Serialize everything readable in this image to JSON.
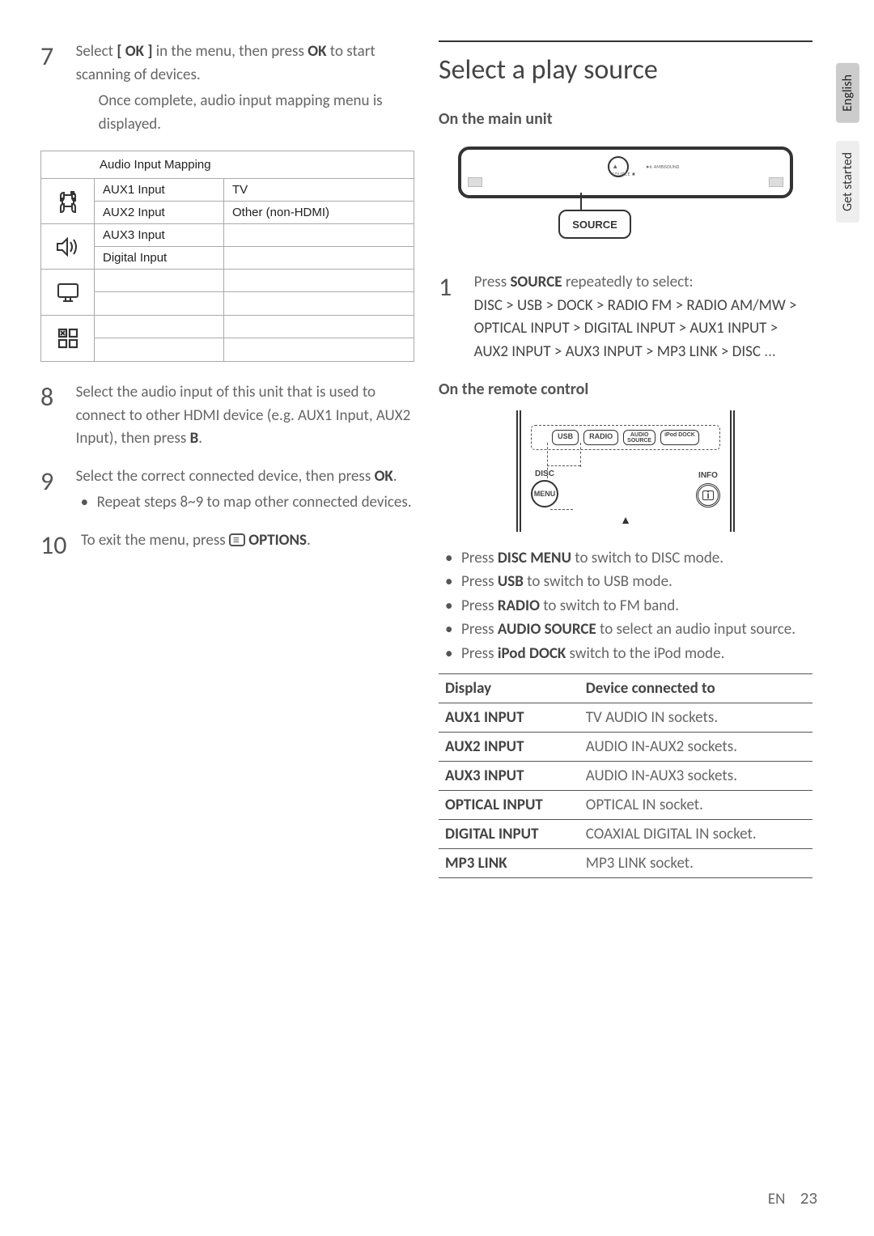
{
  "left": {
    "step7": {
      "num": "7",
      "text_a": "Select ",
      "btn1": "[ OK ]",
      "text_b": " in the menu, then press ",
      "btn2": "OK",
      "text_c": " to start scanning of devices.",
      "cont": "Once complete, audio input mapping menu is displayed."
    },
    "aim": {
      "title": "Audio Input Mapping",
      "rows": [
        {
          "l": "AUX1 Input",
          "r": "TV"
        },
        {
          "l": "AUX2 Input",
          "r": "Other (non-HDMI)"
        },
        {
          "l": "AUX3 Input",
          "r": ""
        },
        {
          "l": "Digital Input",
          "r": ""
        }
      ]
    },
    "step8": {
      "num": "8",
      "text": "Select the audio input of this unit that is used to connect to other HDMI device (e.g. AUX1 Input, AUX2 Input), then press ",
      "btn": "B",
      "dot": "."
    },
    "step9": {
      "num": "9",
      "text_a": "Select the correct connected device, then press ",
      "btn": "OK",
      "dot": ".",
      "sub": "Repeat steps 8~9 to map other connected devices."
    },
    "step10": {
      "num": "10",
      "text_a": " To exit the menu, press ",
      "btn": "OPTIONS",
      "dot": "."
    }
  },
  "right": {
    "heading": "Select a play source",
    "sub1": "On the main unit",
    "unit": {
      "tiny_left": "SOURCE ■",
      "tiny_right": "AMBISOUND",
      "callout": "SOURCE"
    },
    "step1": {
      "num": "1",
      "text_a": "Press ",
      "btn": "SOURCE",
      "text_b": " repeatedly to select: ",
      "chain": "DISC > USB > DOCK > RADIO FM > RADIO AM/MW > OPTICAL INPUT > DIGITAL INPUT > AUX1 INPUT > AUX2 INPUT > AUX3 INPUT > MP3 LINK > DISC",
      "trail": " ..."
    },
    "sub2": "On the remote control",
    "remote": {
      "usb": "USB",
      "radio": "RADIO",
      "audio_top": "AUDIO",
      "audio_bot": "SOURCE",
      "ipod": "iPod DOCK",
      "disc": "DISC",
      "menu": "MENU",
      "info": "INFO",
      "info_icon": "i"
    },
    "bullets": [
      {
        "pre": "Press ",
        "b": "DISC MENU",
        "post": " to switch to DISC mode."
      },
      {
        "pre": "Press ",
        "b": "USB",
        "post": " to switch to USB mode."
      },
      {
        "pre": "Press ",
        "b": "RADIO",
        "post": " to switch to FM band."
      },
      {
        "pre": "Press ",
        "b": "AUDIO SOURCE",
        "post": " to select an audio input source."
      },
      {
        "pre": "Press ",
        "b": "iPod DOCK",
        "post": " switch to the iPod mode."
      }
    ],
    "table": {
      "h1": "Display",
      "h2": "Device connected to",
      "rows": [
        {
          "l": "AUX1 INPUT",
          "r": "TV AUDIO IN sockets."
        },
        {
          "l": "AUX2 INPUT",
          "r": "AUDIO IN-AUX2 sockets."
        },
        {
          "l": "AUX3 INPUT",
          "r": "AUDIO IN-AUX3 sockets."
        },
        {
          "l": "OPTICAL INPUT",
          "r": "OPTICAL IN socket."
        },
        {
          "l": "DIGITAL INPUT",
          "r": "COAXIAL DIGITAL IN socket."
        },
        {
          "l": "MP3 LINK",
          "r": "MP3 LINK socket."
        }
      ]
    }
  },
  "side": {
    "tab1": "English",
    "tab2": "Get started"
  },
  "footer": {
    "lang": "EN",
    "page": "23"
  }
}
